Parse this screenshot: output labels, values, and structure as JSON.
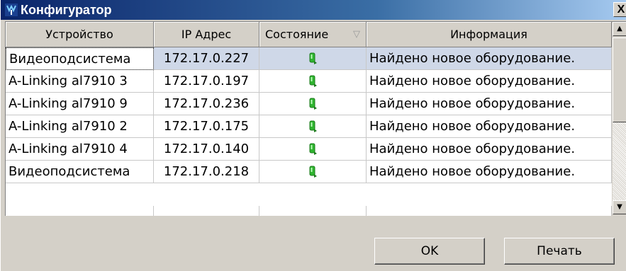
{
  "window": {
    "title": "Конфигуратор",
    "close_label": "X"
  },
  "table": {
    "columns": [
      {
        "label": "Устройство"
      },
      {
        "label": "IP Адрес"
      },
      {
        "label": "Состояние",
        "sort_indicator": "▽"
      },
      {
        "label": "Информация"
      }
    ],
    "rows": [
      {
        "device": "Видеоподсистема",
        "ip": "172.17.0.227",
        "state_icon": "connected-status-icon",
        "info": "Найдено новое оборудование.",
        "selected": true
      },
      {
        "device": "A-Linking al7910 3",
        "ip": "172.17.0.197",
        "state_icon": "connected-status-icon",
        "info": "Найдено новое оборудование."
      },
      {
        "device": "A-Linking al7910 9",
        "ip": "172.17.0.236",
        "state_icon": "connected-status-icon",
        "info": "Найдено новое оборудование."
      },
      {
        "device": "A-Linking al7910 2",
        "ip": "172.17.0.175",
        "state_icon": "connected-status-icon",
        "info": "Найдено новое оборудование."
      },
      {
        "device": "A-Linking al7910 4",
        "ip": "172.17.0.140",
        "state_icon": "connected-status-icon",
        "info": "Найдено новое оборудование."
      },
      {
        "device": "Видеоподсистема",
        "ip": "172.17.0.218",
        "state_icon": "connected-status-icon",
        "info": "Найдено новое оборудование."
      }
    ]
  },
  "buttons": {
    "ok": "OK",
    "print": "Печать"
  },
  "colors": {
    "titlebar_start": "#0a246a",
    "titlebar_end": "#a6caf0",
    "selected_row": "#cfd8e8",
    "status_green": "#2fb52f"
  }
}
